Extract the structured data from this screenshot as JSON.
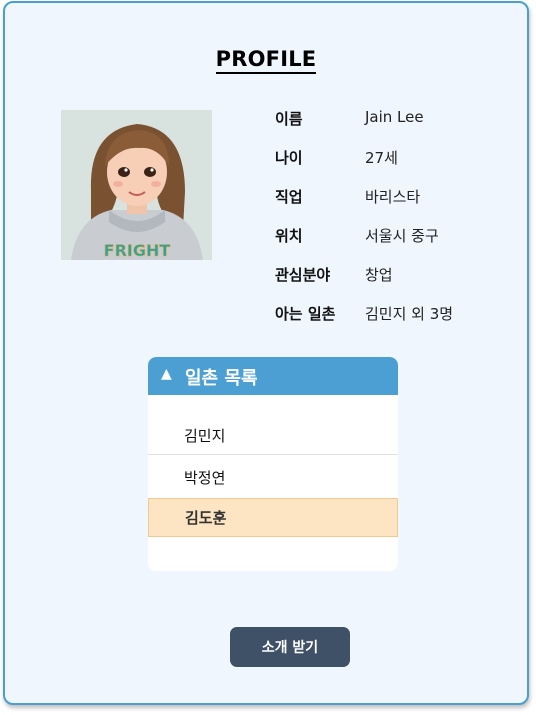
{
  "page": {
    "title": "PROFILE"
  },
  "profile": {
    "rows": [
      {
        "label": "이름",
        "value": "Jain Lee"
      },
      {
        "label": "나이",
        "value": "27세"
      },
      {
        "label": "직업",
        "value": "바리스타"
      },
      {
        "label": "위치",
        "value": "서울시 중구"
      },
      {
        "label": "관심분야",
        "value": "창업"
      },
      {
        "label": "아는 일촌",
        "value": "김민지 외 3명"
      }
    ]
  },
  "friends": {
    "header": "일촌 목록",
    "toggle_icon": "▲",
    "items": [
      "김민지",
      "박정연",
      "김도훈"
    ],
    "selected_index": 2
  },
  "actions": {
    "introduce_label": "소개 받기"
  },
  "colors": {
    "accent": "#4b9fd2",
    "card_bg": "#eff6fd",
    "selected_bg": "#fde4c2",
    "button_bg": "#3f5166"
  }
}
